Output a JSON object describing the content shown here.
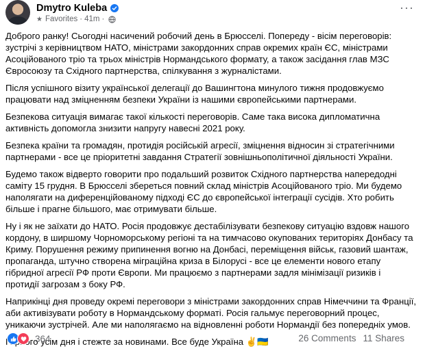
{
  "header": {
    "author": "Dmytro Kuleba",
    "audience": "Favorites",
    "time": "41m",
    "separator": "·"
  },
  "paragraphs": [
    "Доброго ранку! Сьогодні насичений робочий день в Брюсселі. Попереду - вісім переговорів: зустрічі з керівництвом НАТО, міністрами закордонних справ окремих країн ЄС, міністрами Асоційованого тріо та трьох міністрів Нормандського формату, а також засідання глав МЗС Євросоюзу та Східного партнерства, спілкування з журналістами.",
    "Після успішного візиту української делегації до Вашингтона минулого тижня продовжуємо працювати над зміцненням безпеки України із нашими європейськими партнерами.",
    "Безпекова ситуація вимагає такої кількості переговорів. Саме така висока дипломатична активність допомогла знизити напругу навесні 2021 року.",
    "Безпека країни та громадян, протидія російській агресії, зміцнення відносин зі стратегічними партнерами - все це пріоритетні завдання Стратегії зовнішньополітичної діяльності України.",
    "Будемо також відверто говорити про подальший розвиток Східного партнерства напередодні саміту 15 грудня. В Брюсселі збереться повний склад міністрів Асоційованого тріо. Ми будемо наполягати на диференційованому підході ЄС до європейської інтеграції сусідів. Хто робить більше і прагне більшого, має отримувати більше.",
    "Ну і як не заїхати до НАТО. Росія продовжує дестабілізувати безпекову ситуацію вздовж нашого кордону, в ширшому Чорноморському регіоні та на тимчасово окупованих територіях Донбасу та Криму. Порушення режиму припинення вогню на Донбасі, переміщення військ, газовий шантаж, пропаганда, штучно створена міграційна криза в Білорусі - все це елементи нового етапу гібридної агресії РФ проти Європи.  Ми працюємо з партнерами задля мінімізації ризиків і протидії загрозам з боку РФ.",
    "Наприкінці дня проведу окремі переговори з міністрами закордонних справ Німеччини та Франції, аби активізувати роботу в Нормандському форматі. Росія гальмує переговорний процес, уникаючи зустрічей. Але ми наполягаємо на відновленні роботи Нормандії без попередніх умов.",
    "Гарного усім дня і стежте за новинами. Все буде Україна ✌️🇺🇦"
  ],
  "footer": {
    "reactions_count": "364",
    "comments": "26 Comments",
    "shares": "11 Shares"
  },
  "colors": {
    "accent": "#1877f2",
    "love": "#f33e58",
    "secondary_text": "#65676b"
  },
  "icons": [
    "verified-icon",
    "star-icon",
    "globe-icon",
    "more-icon",
    "like-icon",
    "love-icon"
  ]
}
